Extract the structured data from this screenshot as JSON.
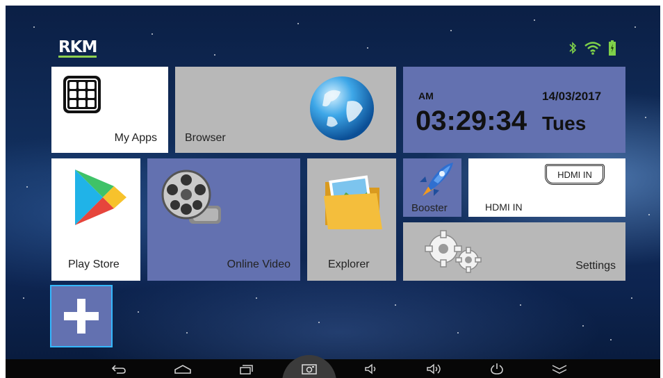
{
  "brand": {
    "logo_text": "RKM"
  },
  "status": {
    "icons": [
      "bluetooth-icon",
      "wifi-icon",
      "battery-icon"
    ]
  },
  "tiles": {
    "my_apps": "My Apps",
    "browser": "Browser",
    "clock": {
      "period": "AM",
      "date": "14/03/2017",
      "time": "03:29:34",
      "day": "Tues"
    },
    "play_store": "Play Store",
    "online_video": "Online Video",
    "explorer": "Explorer",
    "booster": "Booster",
    "hdmi_in": {
      "label": "HDMI IN",
      "badge": "HDMI IN"
    },
    "settings": "Settings"
  },
  "navbar": {
    "buttons": [
      "back-icon",
      "home-icon",
      "recents-icon",
      "screenshot-icon",
      "volume-down-icon",
      "volume-up-icon",
      "power-icon",
      "hide-bar-icon"
    ]
  },
  "colors": {
    "tile_blue": "#6371b0",
    "tile_gray": "#b8b8b8",
    "tile_white": "#ffffff",
    "accent_green": "#8fd14f"
  }
}
